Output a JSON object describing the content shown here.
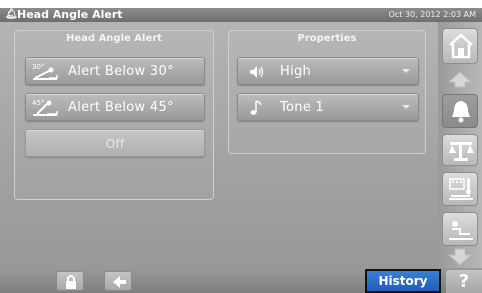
{
  "titlebar": {
    "title": "Head Angle Alert",
    "datetime": "Oct 30, 2012 2:03 AM"
  },
  "left_panel": {
    "title": "Head Angle Alert",
    "buttons": [
      {
        "label": "Alert  Below 30°",
        "icon": "bed-30-degree-icon",
        "icon_text": "30°"
      },
      {
        "label": "Alert  Below 45°",
        "icon": "bed-45-degree-icon",
        "icon_text": "45°"
      }
    ],
    "off_label": "Off"
  },
  "right_panel": {
    "title": "Properties",
    "volume": {
      "value": "High",
      "icon": "speaker-icon"
    },
    "tone": {
      "value": "Tone 1",
      "icon": "music-note-icon"
    }
  },
  "bottombar": {
    "history_label": "History",
    "help_label": "?"
  },
  "colors": {
    "history_blue": "#2a6cc8",
    "background_gray": "#a8a8a8",
    "title_bar": "#7a7a7a"
  }
}
